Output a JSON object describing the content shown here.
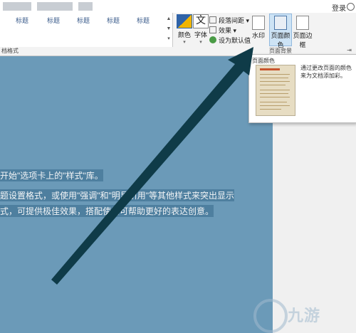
{
  "topbar": {
    "login": "登录"
  },
  "styles_gallery": {
    "items": [
      {
        "title": "",
        "text": ""
      },
      {
        "title": "标题",
        "text": ""
      },
      {
        "title": "标题",
        "text": ""
      },
      {
        "title": "标题",
        "text": ""
      },
      {
        "title": "标题",
        "text": ""
      },
      {
        "title": "标题",
        "text": ""
      }
    ]
  },
  "document_formatting": {
    "group_label": "档格式",
    "colors_label": "颜色",
    "fonts_label": "字体",
    "paragraph_spacing": "段落间距",
    "effects": "效果",
    "set_default": "设为默认值"
  },
  "page_background": {
    "group_label": "页面背景",
    "watermark": "水印",
    "page_color": "页面颜色",
    "page_borders": "页面边框"
  },
  "dropdown": {
    "title": "页面颜色",
    "description": "通过更改页面的颜色来为文档添加彩。"
  },
  "document": {
    "lines": [
      "开始\"选项卡上的\"样式\"库。",
      "题设置格式，或使用\"强调\"和\"明显引用\"等其他样式来突出显示",
      "式，可提供极佳效果，搭配使用可帮助更好的表达创意。"
    ]
  },
  "watermark_brand": "九游"
}
